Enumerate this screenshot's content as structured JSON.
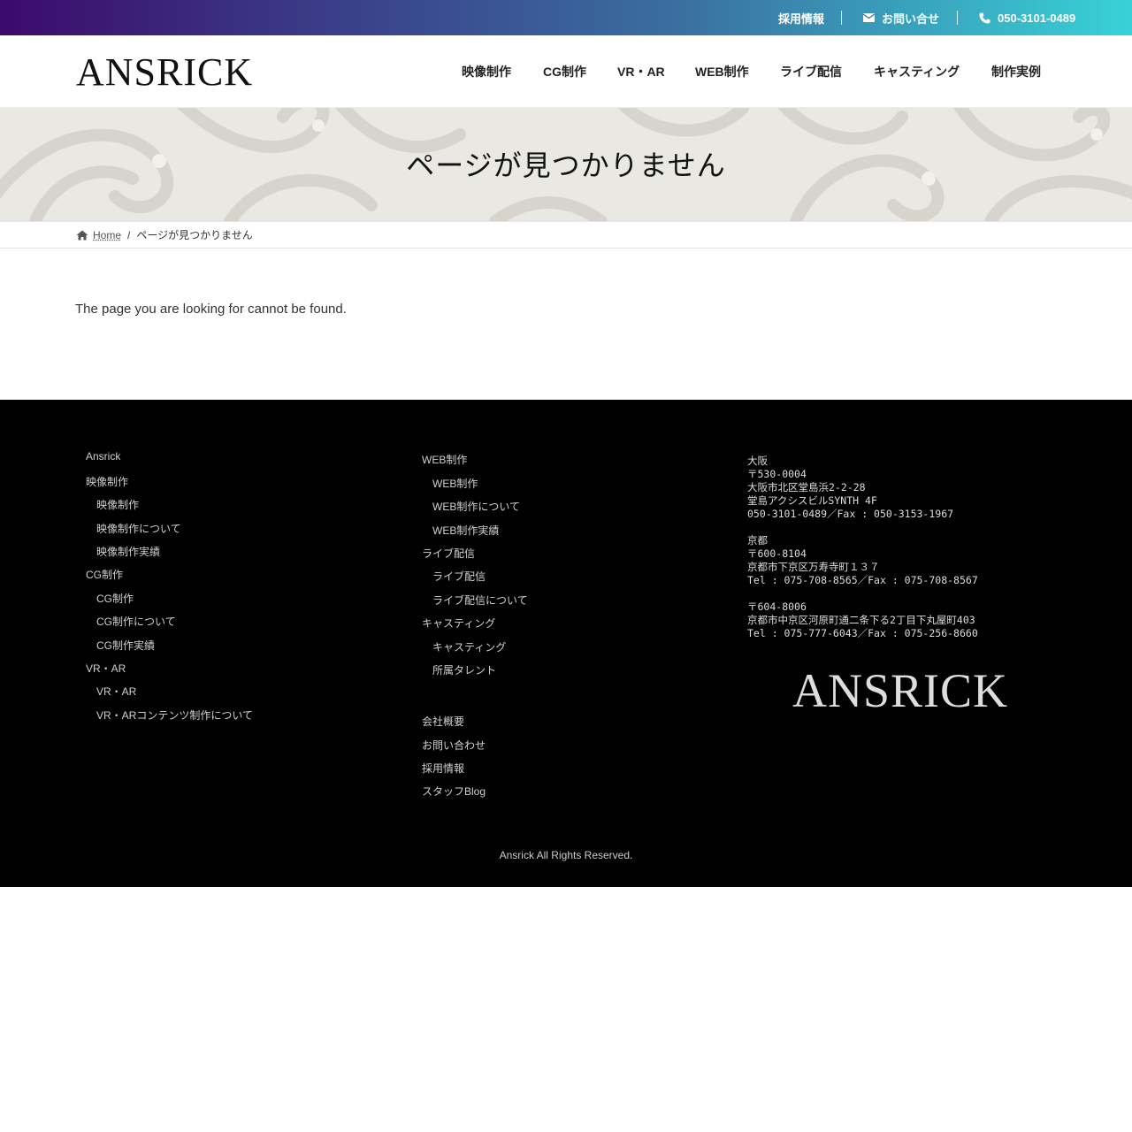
{
  "topbar": {
    "recruit": "採用情報",
    "contact": "お問い合せ",
    "phone": "050-3101-0489"
  },
  "header": {
    "logo": "ANSRICK",
    "nav": [
      "映像制作",
      "CG制作",
      "VR・AR",
      "WEB制作",
      "ライブ配信",
      "キャスティング",
      "制作実例"
    ]
  },
  "hero": {
    "title": "ページが見つかりません"
  },
  "breadcrumb": {
    "home": "Home",
    "sep": "/",
    "current": "ページが見つかりません"
  },
  "main": {
    "message": "The page you are looking for cannot be found."
  },
  "footer": {
    "col1": [
      "Ansrick",
      "映像制作",
      "映像制作",
      "映像制作について",
      "映像制作実績",
      "CG制作",
      "CG制作",
      "CG制作について",
      "CG制作実績",
      "VR・AR",
      "VR・AR",
      "VR・ARコンテンツ制作について"
    ],
    "col2": [
      "WEB制作",
      "WEB制作",
      "WEB制作について",
      "WEB制作実績",
      "ライブ配信",
      "ライブ配信",
      "ライブ配信について",
      "キャスティング",
      "キャスティング",
      "所属タレント",
      "会社概要",
      "お問い合わせ",
      "採用情報",
      "スタッフBlog"
    ],
    "address": "大阪\n〒530-0004\n大阪市北区堂島浜2-2-28\n堂島アクシスビルSYNTH 4F\n050-3101-0489／Fax : 050-3153-1967\n\n京都\n〒600-8104\n京都市下京区万寿寺町１３７\nTel : 075-708-8565／Fax : 075-708-8567\n\n〒604-8006\n京都市中京区河原町通二条下る2丁目下丸屋町403\nTel : 075-777-6043／Fax : 075-256-8660",
    "logo": "ANSRICK",
    "copyright": "Ansrick All Rights Reserved."
  },
  "colors": {
    "gradient_start": "#3c0a6b",
    "gradient_end": "#38d2d8",
    "footer_bg": "#000000"
  }
}
